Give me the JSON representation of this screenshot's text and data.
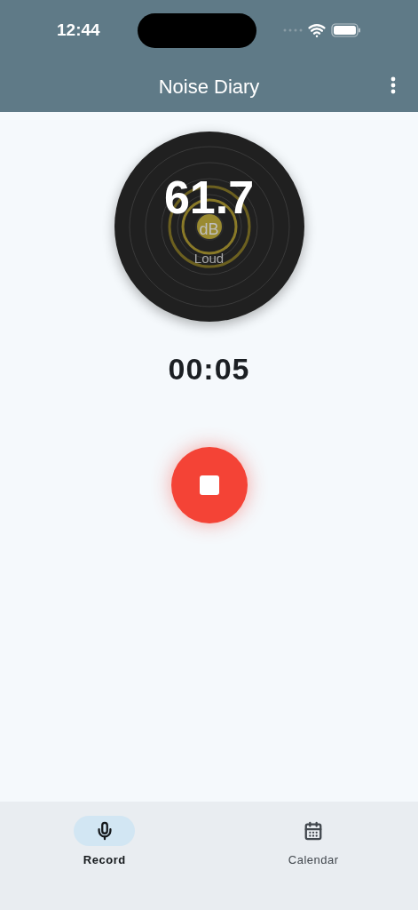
{
  "status_bar": {
    "time": "12:44"
  },
  "app_bar": {
    "title": "Noise Diary"
  },
  "meter": {
    "reading": "61.7",
    "unit": "dB",
    "category": "Loud"
  },
  "timer": "00:05",
  "recording": true,
  "nav": [
    {
      "label": "Record",
      "selected": true
    },
    {
      "label": "Calendar",
      "selected": false
    }
  ]
}
